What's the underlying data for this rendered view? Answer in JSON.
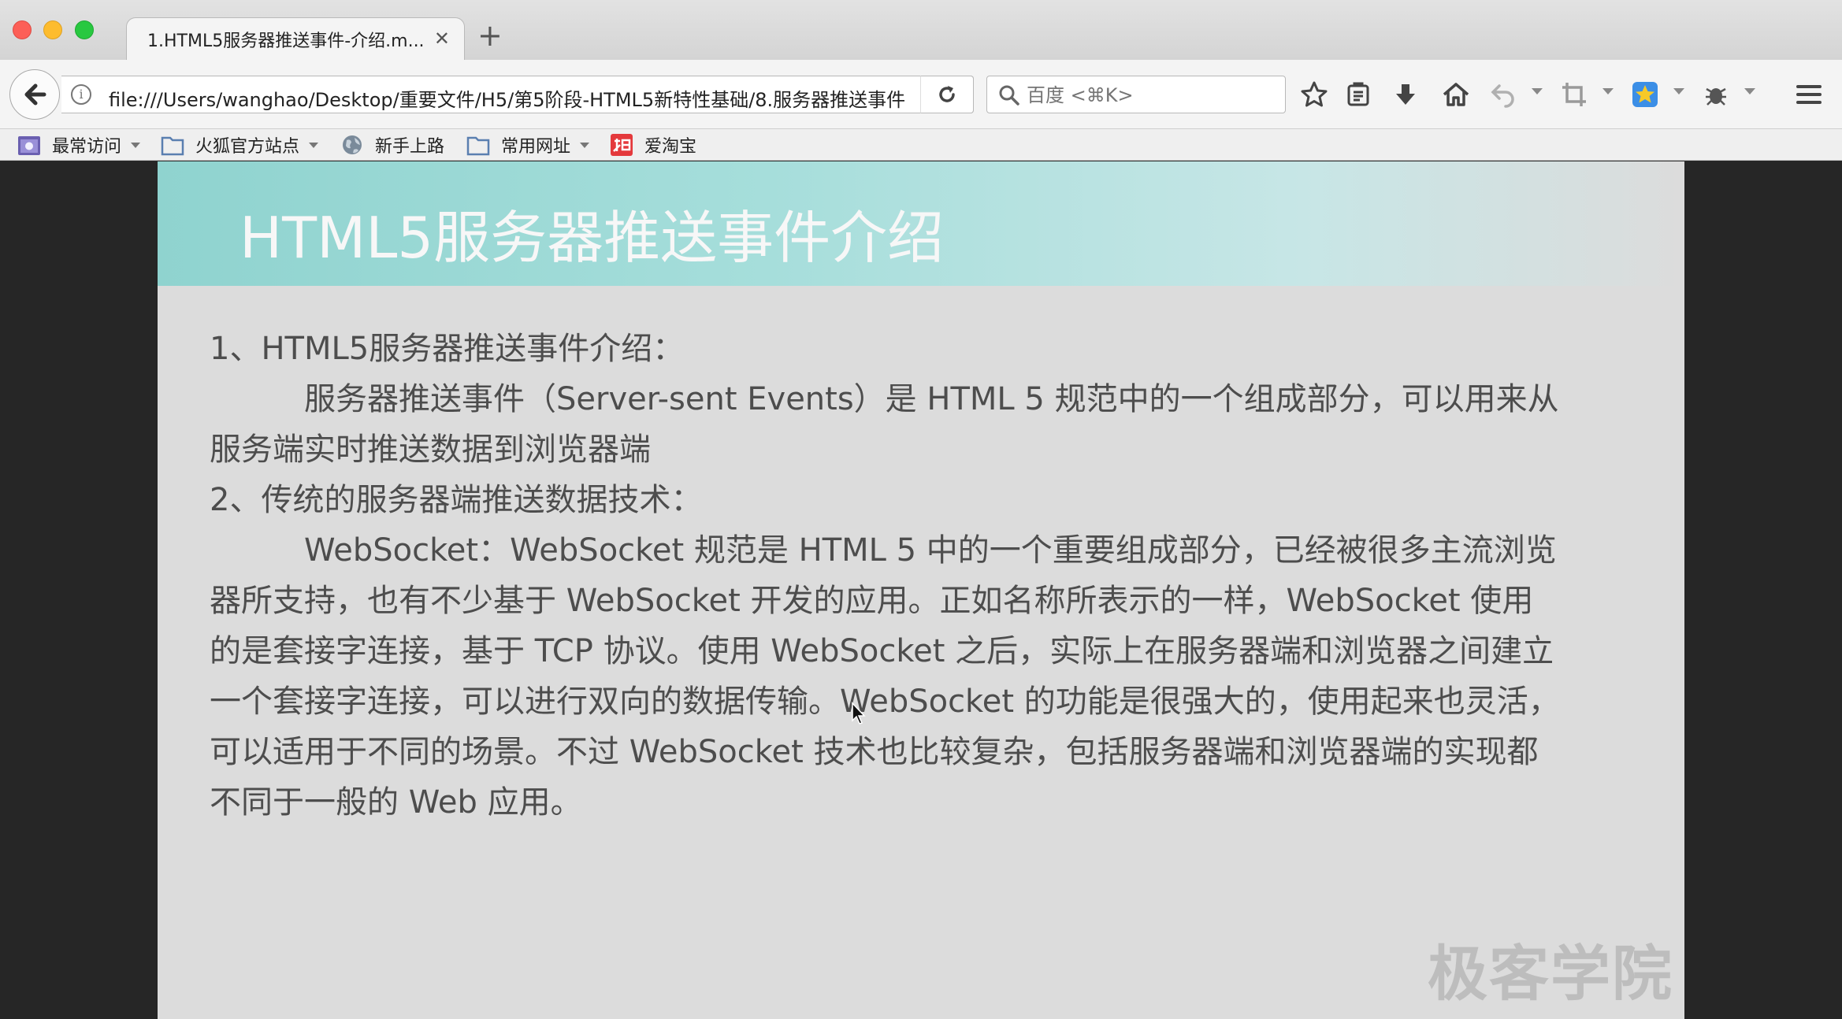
{
  "browser": {
    "tab": {
      "title": "1.HTML5服务器推送事件-介绍.m...",
      "close": "✕"
    },
    "new_tab": "+",
    "url": "file:///Users/wanghao/Desktop/重要文件/H5/第5阶段-HTML5新特性基础/8.服务器推送事件",
    "search_placeholder": "百度 <⌘K>"
  },
  "bookmarks": [
    {
      "label": "最常访问",
      "icon": "most-visited-icon",
      "dropdown": true
    },
    {
      "label": "火狐官方站点",
      "icon": "folder-icon",
      "dropdown": true
    },
    {
      "label": "新手上路",
      "icon": "globe-icon",
      "dropdown": false
    },
    {
      "label": "常用网址",
      "icon": "folder-icon",
      "dropdown": true
    },
    {
      "label": "爱淘宝",
      "icon": "taobao-icon",
      "dropdown": false
    }
  ],
  "slide": {
    "title": "HTML5服务器推送事件介绍",
    "paragraphs": [
      "1、HTML5服务器推送事件介绍：",
      "服务器推送事件（Server-sent Events）是 HTML 5 规范中的一个组成部分，可以用来从服务端实时推送数据到浏览器端",
      "2、传统的服务器端推送数据技术：",
      "WebSocket：WebSocket 规范是 HTML 5 中的一个重要组成部分，已经被很多主流浏览器所支持，也有不少基于 WebSocket 开发的应用。正如名称所表示的一样，WebSocket 使用的是套接字连接，基于 TCP 协议。使用 WebSocket 之后，实际上在服务器端和浏览器之间建立一个套接字连接，可以进行双向的数据传输。WebSocket 的功能是很强大的，使用起来也灵活，可以适用于不同的场景。不过 WebSocket 技术也比较复杂，包括服务器端和浏览器端的实现都不同于一般的 Web 应用。"
    ],
    "watermark": "极客学院"
  },
  "colors": {
    "header_accent": "#8fd3cf",
    "slide_bg": "#dcdcdc",
    "body_text": "#4d4d4d"
  }
}
